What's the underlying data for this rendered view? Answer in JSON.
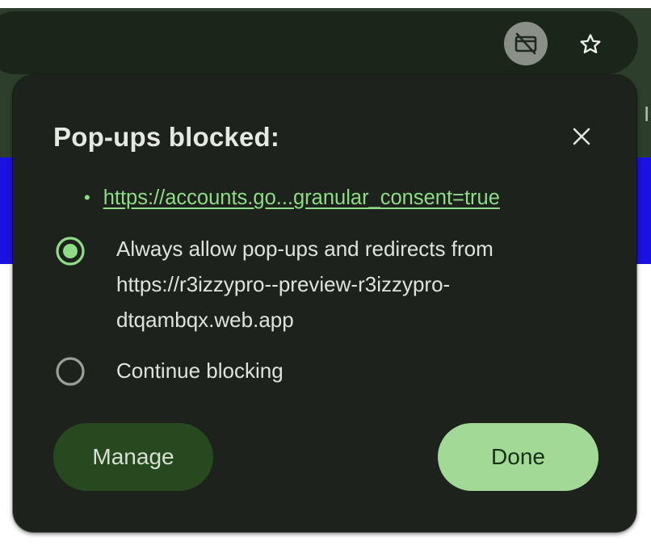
{
  "browser": {
    "toolbar_icons": {
      "popup_blocked": "popup-blocked-icon",
      "bookmark": "star-icon"
    },
    "edge_fragment": "I"
  },
  "dialog": {
    "title": "Pop-ups blocked:",
    "close_icon": "close-icon",
    "blocked_urls": [
      {
        "bullet": "•",
        "text": "https://accounts.go...granular_consent=true"
      }
    ],
    "options": [
      {
        "label_line1": "Always allow pop-ups and redirects from",
        "label_line2": "https://r3izzypro--preview-r3izzypro-",
        "label_line3": "dtqambqx.web.app",
        "selected": true
      },
      {
        "label_line1": "Continue blocking",
        "selected": false
      }
    ],
    "buttons": {
      "manage_label": "Manage",
      "done_label": "Done"
    }
  },
  "colors": {
    "accent": "#8fdc86",
    "done_button_bg": "#a3d996",
    "manage_button_bg": "#27491f",
    "dialog_bg": "#1d221c",
    "page_blue": "#1a12e0"
  }
}
